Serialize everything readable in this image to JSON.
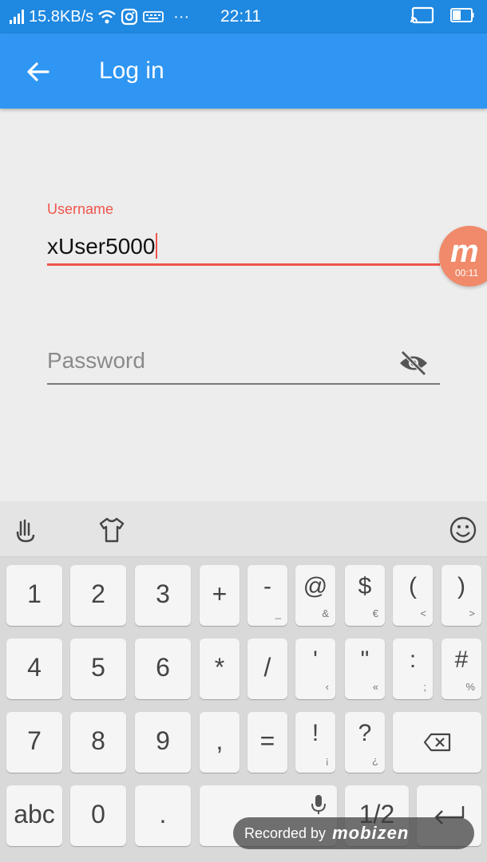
{
  "status_bar": {
    "network_speed": "15.8KB/s",
    "more_indicator": "···",
    "time": "22:11"
  },
  "app_bar": {
    "title": "Log in"
  },
  "form": {
    "username_label": "Username",
    "username_value": "xUser5000",
    "password_placeholder": "Password"
  },
  "recorder": {
    "logo": "m",
    "timer": "00:11"
  },
  "keyboard": {
    "rows": [
      [
        {
          "main": "1"
        },
        {
          "main": "2"
        },
        {
          "main": "3"
        },
        {
          "main": "+"
        },
        {
          "main": "-",
          "sub": "_"
        },
        {
          "main": "@",
          "sub": "&"
        },
        {
          "main": "$",
          "sub": "€"
        },
        {
          "main": "(",
          "sub": "<"
        },
        {
          "main": ")",
          "sub": ">"
        }
      ],
      [
        {
          "main": "4"
        },
        {
          "main": "5"
        },
        {
          "main": "6"
        },
        {
          "main": "*"
        },
        {
          "main": "/"
        },
        {
          "main": "'",
          "sub": "‹"
        },
        {
          "main": "\"",
          "sub": "«"
        },
        {
          "main": ":",
          "sub": ";"
        },
        {
          "main": "#",
          "sub": "%"
        }
      ],
      [
        {
          "main": "7"
        },
        {
          "main": "8"
        },
        {
          "main": "9"
        },
        {
          "main": ","
        },
        {
          "main": "="
        },
        {
          "main": "!",
          "sub": "¡"
        },
        {
          "main": "?",
          "sub": "¿"
        }
      ],
      [
        {
          "main": "abc"
        },
        {
          "main": "0"
        },
        {
          "main": "."
        }
      ]
    ],
    "fraction_key": "1/2"
  },
  "watermark": {
    "text": "Recorded by",
    "brand": "mobizen"
  },
  "colors": {
    "status_bar": "#1f88e0",
    "app_bar": "#2f96f3",
    "accent": "#f0554c",
    "background": "#ededed"
  }
}
